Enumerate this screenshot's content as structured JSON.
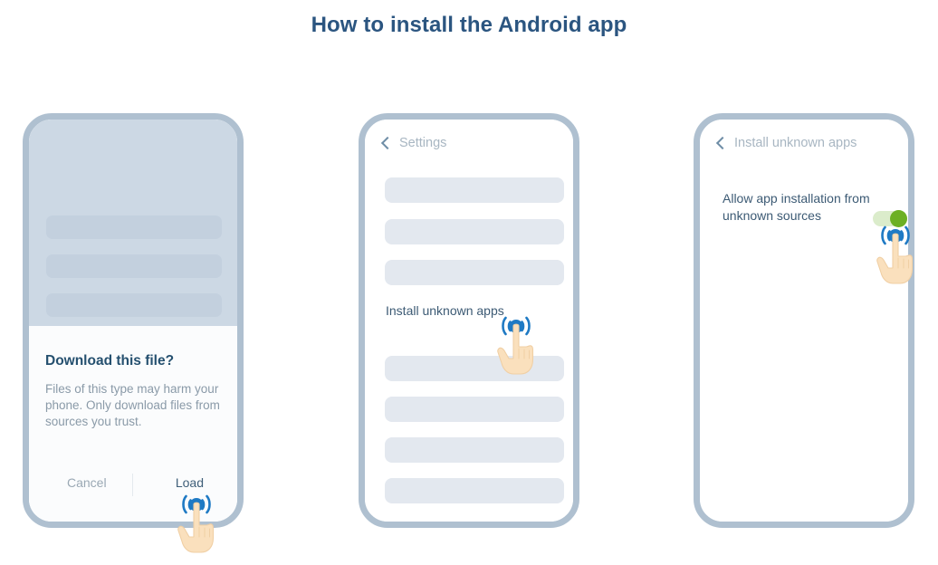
{
  "page": {
    "title": "How to install the Android app",
    "background": "#ffffff",
    "title_color": "#2b5580"
  },
  "colors": {
    "frame": "#afc0d0",
    "backdrop": "#ccd8e4",
    "placeholder_bar": "#e3e8ef",
    "heading": "#25506f",
    "body_text": "#8a9aa8",
    "setting_text": "#3c5a74",
    "nav_title": "#a8b6c2",
    "toggle_track": "#dbeccb",
    "toggle_knob": "#6cb023",
    "tap_blue": "#1f7ac4",
    "hand_skin": "#fae0bd"
  },
  "steps": [
    {
      "id": "step-1-download-dialog",
      "placeholder_bars": 3,
      "dialog": {
        "title": "Download this file?",
        "body": "Files of this type may harm your phone. Only download files from sources you trust.",
        "cancel_label": "Cancel",
        "confirm_label": "Load"
      },
      "tap_target": "Load"
    },
    {
      "id": "step-2-settings-list",
      "nav": {
        "back_icon": "chevron-left-icon",
        "title": "Settings"
      },
      "bars_above": 3,
      "list_item_label": "Install unknown apps",
      "bars_below": 4,
      "tap_target": "Install unknown apps"
    },
    {
      "id": "step-3-allow-toggle",
      "nav": {
        "back_icon": "chevron-left-icon",
        "title": "Install unknown apps"
      },
      "setting_label": "Allow app installation from unknown sources",
      "toggle": {
        "state": "on",
        "track_color": "#dbeccb",
        "knob_color": "#6cb023"
      },
      "tap_target": "Allow app installation toggle"
    }
  ],
  "icons": {
    "tap": "tap-gesture-icon",
    "back": "chevron-left-icon",
    "toggle": "toggle-switch-icon"
  }
}
